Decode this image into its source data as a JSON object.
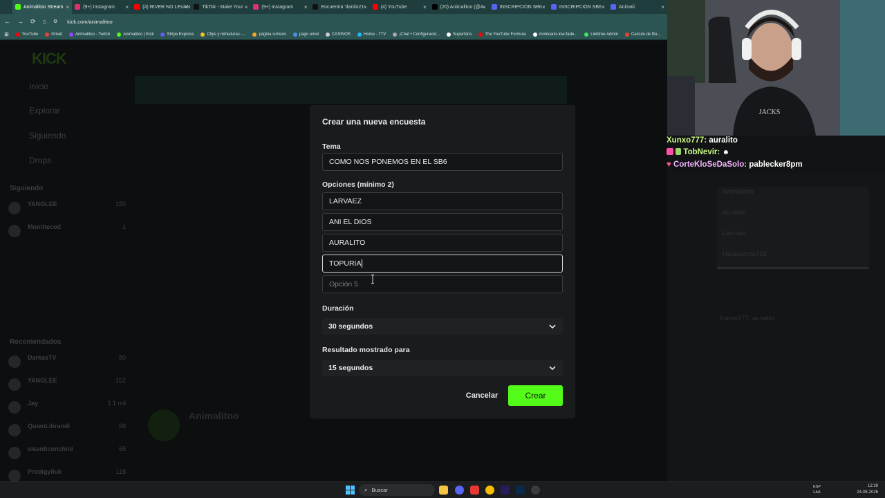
{
  "browser": {
    "tabs": [
      {
        "label": "Animalitoo Stream",
        "color": "#53fc18",
        "active": true
      },
      {
        "label": "(9+) Instagram",
        "color": "#e1306c"
      },
      {
        "label": "(4) RIVER NO LEVAN",
        "color": "#ff0000"
      },
      {
        "label": "TikTok - Make Your",
        "color": "#111111"
      },
      {
        "label": "(9+) Instagram",
        "color": "#e1306c"
      },
      {
        "label": "Encuentra 'danilo21'",
        "color": "#111111"
      },
      {
        "label": "(4) YouTube",
        "color": "#ff0000"
      },
      {
        "label": "(20) Animalitoo (@A",
        "color": "#000000"
      },
      {
        "label": "INSCRIPCIÓN SB6",
        "color": "#5865f2"
      },
      {
        "label": "INSCRIPCIÓN SB6",
        "color": "#5865f2"
      },
      {
        "label": "Animali",
        "color": "#5865f2"
      }
    ],
    "url": "kick.com/animalitoo",
    "bookmarks": [
      {
        "label": "YouTube",
        "color": "#ff0000"
      },
      {
        "label": "Gmail",
        "color": "#ea4335"
      },
      {
        "label": "Animalitoo - Twitch",
        "color": "#9146ff"
      },
      {
        "label": "Animalitoo | Kick",
        "color": "#53fc18"
      },
      {
        "label": "Stripe Express",
        "color": "#635bff"
      },
      {
        "label": "Clips y miniaturas -...",
        "color": "#f5c518"
      },
      {
        "label": "página sorteos",
        "color": "#f5a623"
      },
      {
        "label": "pago emel",
        "color": "#4a90e2"
      },
      {
        "label": "CASINOS",
        "color": "#cccccc"
      },
      {
        "label": "Home - 7TV",
        "color": "#29b6f6"
      },
      {
        "label": "¡Chat • Configuració...",
        "color": "#aaaaaa"
      },
      {
        "label": "Superfans",
        "color": "#ffffff"
      },
      {
        "label": "The YouTube Formula",
        "color": "#ff0000"
      },
      {
        "label": "mohicano-low-fade...",
        "color": "#ffffff"
      },
      {
        "label": "Linktree Admin",
        "color": "#43e660"
      },
      {
        "label": "Calculo de Bo...",
        "color": "#ea4335"
      }
    ]
  },
  "modal": {
    "title": "Crear una nueva encuesta",
    "topic_label": "Tema",
    "topic_value": "COMO NOS PONEMOS EN EL SB6",
    "options_label": "Opciones (mínimo 2)",
    "options": [
      "LARVAEZ",
      "ANI EL DIOS",
      "AURALITO",
      "TOPURIA"
    ],
    "option5_placeholder": "Opción 5",
    "duration_label": "Duración",
    "duration_value": "30 segundos",
    "result_label": "Resultado mostrado para",
    "result_value": "15 segundos",
    "cancel_label": "Cancelar",
    "create_label": "Crear"
  },
  "stream_chat": [
    {
      "user": "Xunxo777:",
      "msg": "auralito"
    },
    {
      "user": "TobNevir:",
      "msg": ""
    },
    {
      "user": "CorteKloSeDaSolo:",
      "msg": "pablecker8pm"
    }
  ],
  "background": {
    "logo": "KICK",
    "nav": [
      "Inicio",
      "Explorar",
      "Siguiendo",
      "Drops"
    ],
    "following_label": "Siguiendo",
    "recommended_label": "Recomendados",
    "following": [
      {
        "name": "YANGLEE",
        "viewers": "150"
      },
      {
        "name": "Monthecod",
        "viewers": "1"
      }
    ],
    "recommended": [
      {
        "name": "DarkasTV",
        "viewers": "80"
      },
      {
        "name": "YANGLEE",
        "viewers": "152"
      },
      {
        "name": "Jay",
        "viewers": "1.1 mil"
      },
      {
        "name": "QuienLibrandi",
        "viewers": "68"
      },
      {
        "name": "elsanticonchini",
        "viewers": "65"
      },
      {
        "name": "Prodigyiluk",
        "viewers": "118"
      }
    ],
    "channel_name": "Animalitoo",
    "chat_lines": [
      "Xunxo777: auralito"
    ],
    "leaderboard": [
      "Animalitoo",
      "Auralito",
      "Larvaez",
      "Halaasonte318"
    ]
  },
  "taskbar": {
    "search_placeholder": "Buscar",
    "lang_line1": "ESP",
    "lang_line2": "LAA",
    "time": "12:29",
    "date": "24-08-2026"
  }
}
